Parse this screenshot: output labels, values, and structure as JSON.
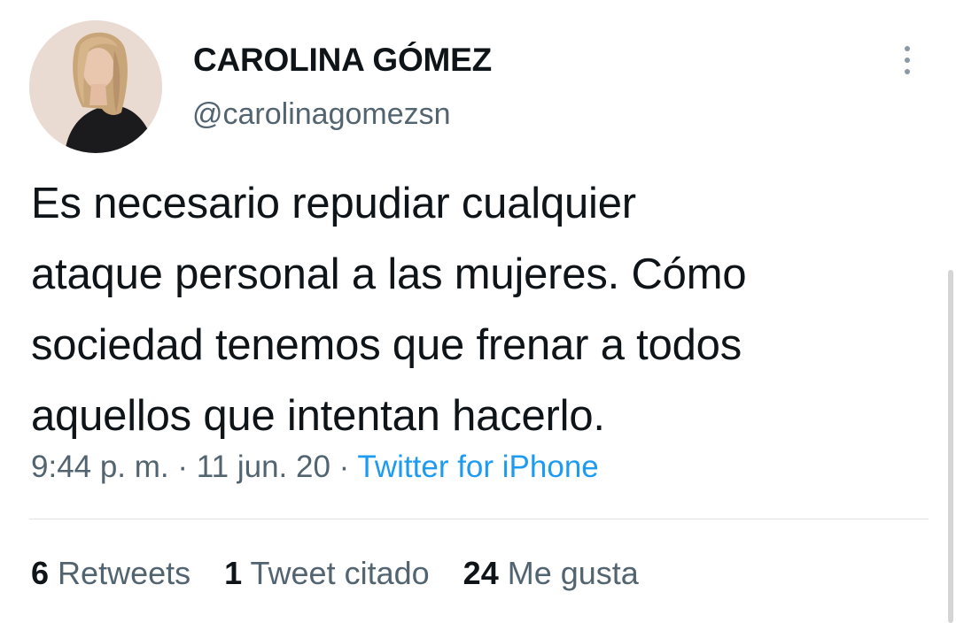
{
  "author": {
    "display_name": "CAROLINA GÓMEZ",
    "handle": "@carolinagomezsn",
    "avatar_icon": "profile-photo"
  },
  "tweet": {
    "lines": [
      "Es necesario repudiar cualquier",
      "ataque personal a las mujeres. Cómo",
      "sociedad tenemos que frenar a todos",
      "aquellos que intentan hacerlo."
    ]
  },
  "meta": {
    "time": "9:44 p. m.",
    "separator": "·",
    "date": "11 jun. 20",
    "source": "Twitter for iPhone"
  },
  "stats": {
    "retweets_count": "6",
    "retweets_label": "Retweets",
    "quotes_count": "1",
    "quotes_label": "Tweet citado",
    "likes_count": "24",
    "likes_label": "Me gusta"
  },
  "colors": {
    "text_primary": "#0f1419",
    "text_secondary": "#536471",
    "link": "#1d9bf0"
  }
}
